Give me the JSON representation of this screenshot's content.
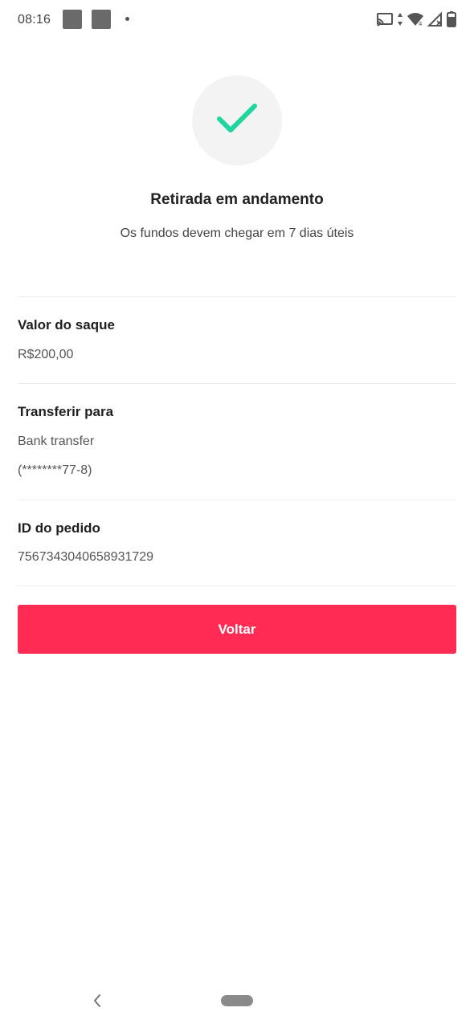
{
  "status_bar": {
    "time": "08:16",
    "icons": [
      "notification-square-icon",
      "notification-square-icon",
      "notification-dot-icon",
      "cast-icon",
      "data-arrows-icon",
      "wifi-icon",
      "signal-icon",
      "battery-icon"
    ]
  },
  "header": {
    "icon": "checkmark-icon",
    "title": "Retirada em andamento",
    "subtitle": "Os fundos devem chegar em 7 dias úteis"
  },
  "details": {
    "amount": {
      "label": "Valor do saque",
      "value": "R$200,00"
    },
    "transfer": {
      "label": "Transferir para",
      "method": "Bank transfer",
      "account": "(********77-8)"
    },
    "order": {
      "label": "ID do pedido",
      "value": "7567343040658931729"
    }
  },
  "actions": {
    "back_label": "Voltar"
  },
  "nav_bar": {
    "icons": [
      "back-chevron-icon",
      "home-pill-icon"
    ]
  },
  "colors": {
    "accent": "#fe2c55",
    "check": "#20d5a0",
    "check_bg": "#f3f3f3"
  }
}
